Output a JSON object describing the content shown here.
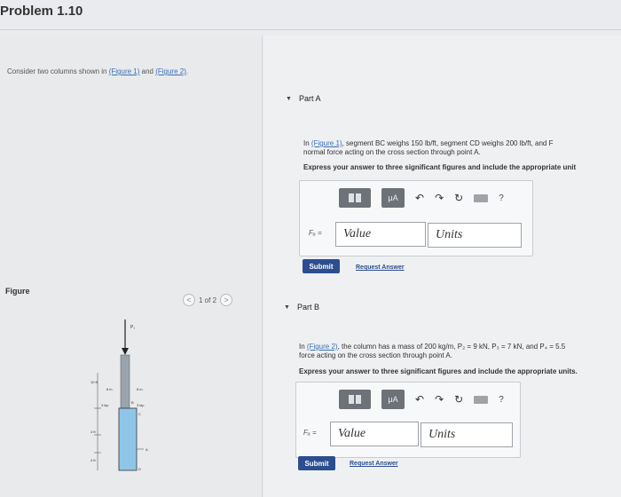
{
  "header": {
    "title": "Problem 1.10"
  },
  "left": {
    "intro_prefix": "Consider two columns shown in ",
    "figure1_link": "(Figure 1)",
    "intro_and": " and ",
    "figure2_link": "(Figure 2)",
    "intro_suffix": ".",
    "figure_label": "Figure",
    "pager": {
      "prev": "<",
      "text": "1 of 2",
      "next": ">"
    },
    "figure": {
      "load_top": "P₁",
      "dim_left_top": "10 ft",
      "dim_mid": "8 in.",
      "dim_right": "8 in.",
      "load_left": "3 kip",
      "load_right": "3 kip",
      "label_b": "B",
      "label_c": "C",
      "label_a": "A",
      "label_d": "D",
      "dim_lower1": "4 ft",
      "dim_lower2": "4 ft"
    }
  },
  "partA": {
    "title": "Part A",
    "link": "(Figure 1)",
    "text1_prefix": "In ",
    "text1_suffix": ", segment BC weighs 150 lb/ft, segment CD weighs 200 lb/ft, and F",
    "text2": "normal force acting on the cross section through point A.",
    "instruction": "Express your answer to three significant figures and include the appropriate unit",
    "var_label": "Fₐ =",
    "value_placeholder": "Value",
    "units_placeholder": "Units",
    "submit": "Submit",
    "request": "Request Answer"
  },
  "partB": {
    "title": "Part B",
    "link": "(Figure 2)",
    "text1_prefix": "In ",
    "text1_suffix": ", the column has a mass of 200 kg/m, P₂ = 9 kN, P₃ = 7 kN, and P₄ = 5.5",
    "text2": "force acting on the cross section through point A.",
    "instruction": "Express your answer to three significant figures and include the appropriate units.",
    "var_label": "Fₐ =",
    "value_placeholder": "Value",
    "units_placeholder": "Units",
    "submit": "Submit",
    "request": "Request Answer"
  },
  "toolbar": {
    "mu_label": "μA",
    "undo_icon": "↶",
    "redo_icon": "↷",
    "reset_icon": "↻",
    "help": "?"
  }
}
